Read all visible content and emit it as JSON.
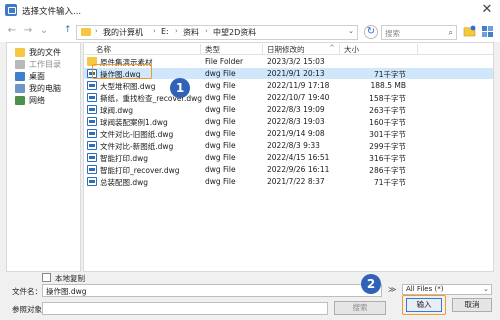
{
  "window": {
    "title": "选择文件输入...",
    "close_label": "✕"
  },
  "navbar": {
    "back_glyph": "←",
    "forward_glyph": "→",
    "history_glyph": "⌄",
    "up_glyph": "↑",
    "address_segments": [
      "我的计算机",
      "E:",
      "资料",
      "中望2D资料"
    ],
    "address_separator": "›",
    "address_dropdown_glyph": "⌄",
    "refresh_glyph": "↻",
    "search_placeholder": "搜索",
    "search_icon_glyph": "⌕"
  },
  "sidebar": {
    "items": [
      {
        "label": "我的文件",
        "icon": "folder-icon",
        "color": "#f5c842"
      },
      {
        "label": "工作目录",
        "icon": "workdir-icon",
        "color": "#b8b8b8"
      },
      {
        "label": "桌面",
        "icon": "desktop-icon",
        "color": "#3f7fd0"
      },
      {
        "label": "我的电脑",
        "icon": "computer-icon",
        "color": "#6d97c9"
      },
      {
        "label": "网络",
        "icon": "network-icon",
        "color": "#4a8f4a"
      }
    ]
  },
  "file_list": {
    "columns": {
      "name": "名称",
      "type": "类型",
      "date": "日期修改的",
      "size": "大小"
    },
    "sort_glyph": "^",
    "rows": [
      {
        "name": "原件集演示素材",
        "type": "File Folder",
        "date": "2023/3/2 15:03",
        "size": "",
        "kind": "folder"
      },
      {
        "name": "操作图.dwg",
        "type": "dwg File",
        "date": "2021/9/1 20:13",
        "size": "71千字节",
        "kind": "dwg",
        "selected": true
      },
      {
        "name": "大型堆积图.dwg",
        "type": "dwg File",
        "date": "2022/11/9 17:18",
        "size": "188.5 MB",
        "kind": "dwg"
      },
      {
        "name": "撕纸，重找检查_recover.dwg",
        "type": "dwg File",
        "date": "2022/10/7 19:40",
        "size": "158千字节",
        "kind": "dwg"
      },
      {
        "name": "球阀.dwg",
        "type": "dwg File",
        "date": "2022/8/3 19:09",
        "size": "263千字节",
        "kind": "dwg"
      },
      {
        "name": "球阀装配案例1.dwg",
        "type": "dwg File",
        "date": "2022/8/3 19:03",
        "size": "160千字节",
        "kind": "dwg"
      },
      {
        "name": "文件对比-旧图纸.dwg",
        "type": "dwg File",
        "date": "2021/9/14 9:08",
        "size": "301千字节",
        "kind": "dwg"
      },
      {
        "name": "文件对比-新图纸.dwg",
        "type": "dwg File",
        "date": "2022/8/3 9:33",
        "size": "299千字节",
        "kind": "dwg"
      },
      {
        "name": "智能打印.dwg",
        "type": "dwg File",
        "date": "2022/4/15 16:51",
        "size": "316千字节",
        "kind": "dwg"
      },
      {
        "name": "智能打印_recover.dwg",
        "type": "dwg File",
        "date": "2022/9/26 16:11",
        "size": "286千字节",
        "kind": "dwg"
      },
      {
        "name": "总装配图.dwg",
        "type": "dwg File",
        "date": "2021/7/22 8:37",
        "size": "71千字节",
        "kind": "dwg"
      }
    ]
  },
  "callouts": {
    "first": "1",
    "second": "2"
  },
  "bottom": {
    "local_copy_label": "本地复制",
    "filename_label": "文件名：",
    "filename_value": "操作图.dwg",
    "filename_drop_glyph": "⌄",
    "reference_label": "参照对象:",
    "reference_value": "",
    "search_button": "搜索",
    "more_glyph": "≫",
    "filter_value": "All Files (*)",
    "filter_drop_glyph": "⌄",
    "input_button": "输入",
    "cancel_button": "取消"
  },
  "colors": {
    "selected_row": "#cfe6fb",
    "highlight": "#f39a2b",
    "callout": "#2f62b8",
    "dwg_icon": "#2d6fb6"
  }
}
